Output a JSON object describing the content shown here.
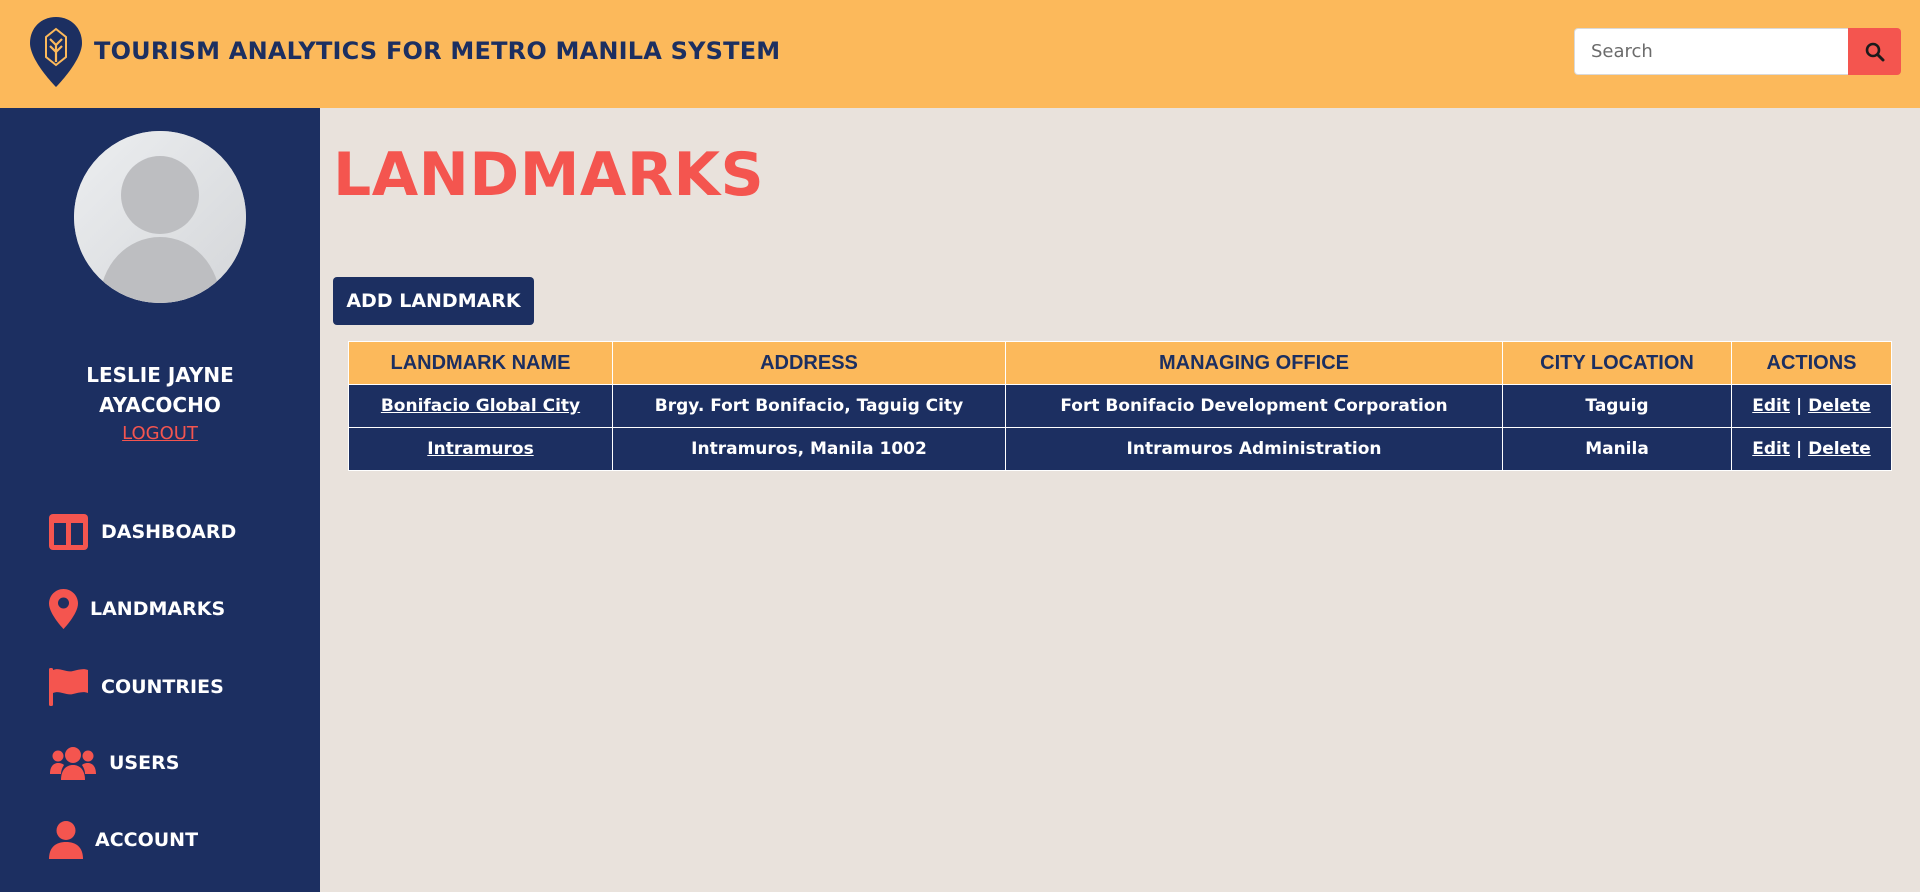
{
  "header": {
    "app_title": "TOURISM ANALYTICS FOR METRO MANILA SYSTEM",
    "logo_icon": "map-pin-logo-icon",
    "search": {
      "placeholder": "Search",
      "value": "",
      "button_icon": "search-icon"
    }
  },
  "colors": {
    "header_bg": "#fcb95b",
    "sidebar_bg": "#1c2f61",
    "accent": "#f4554f",
    "content_bg": "#e9e2dc",
    "table_header_bg": "#fcb95b",
    "table_row_bg": "#1c2f61"
  },
  "sidebar": {
    "user": {
      "name_line1": "LESLIE JAYNE",
      "name_line2": "AYACOCHO",
      "avatar_icon": "user-avatar-icon"
    },
    "logout_label": "LOGOUT",
    "items": [
      {
        "label": "DASHBOARD",
        "icon": "dashboard-icon"
      },
      {
        "label": "LANDMARKS",
        "icon": "map-marker-icon"
      },
      {
        "label": "COUNTRIES",
        "icon": "flag-icon"
      },
      {
        "label": "USERS",
        "icon": "users-icon"
      },
      {
        "label": "ACCOUNT",
        "icon": "user-icon"
      }
    ]
  },
  "main": {
    "page_title": "LANDMARKS",
    "add_button_label": "ADD LANDMARK",
    "table": {
      "headers": [
        "LANDMARK NAME",
        "ADDRESS",
        "MANAGING OFFICE",
        "CITY LOCATION",
        "ACTIONS"
      ],
      "rows": [
        {
          "name": "Bonifacio Global City",
          "address": "Brgy. Fort Bonifacio, Taguig City",
          "office": "Fort Bonifacio Development Corporation",
          "city": "Taguig",
          "edit": "Edit",
          "sep": "|",
          "delete": "Delete"
        },
        {
          "name": "Intramuros",
          "address": "Intramuros, Manila 1002",
          "office": "Intramuros Administration",
          "city": "Manila",
          "edit": "Edit",
          "sep": "|",
          "delete": "Delete"
        }
      ]
    }
  }
}
